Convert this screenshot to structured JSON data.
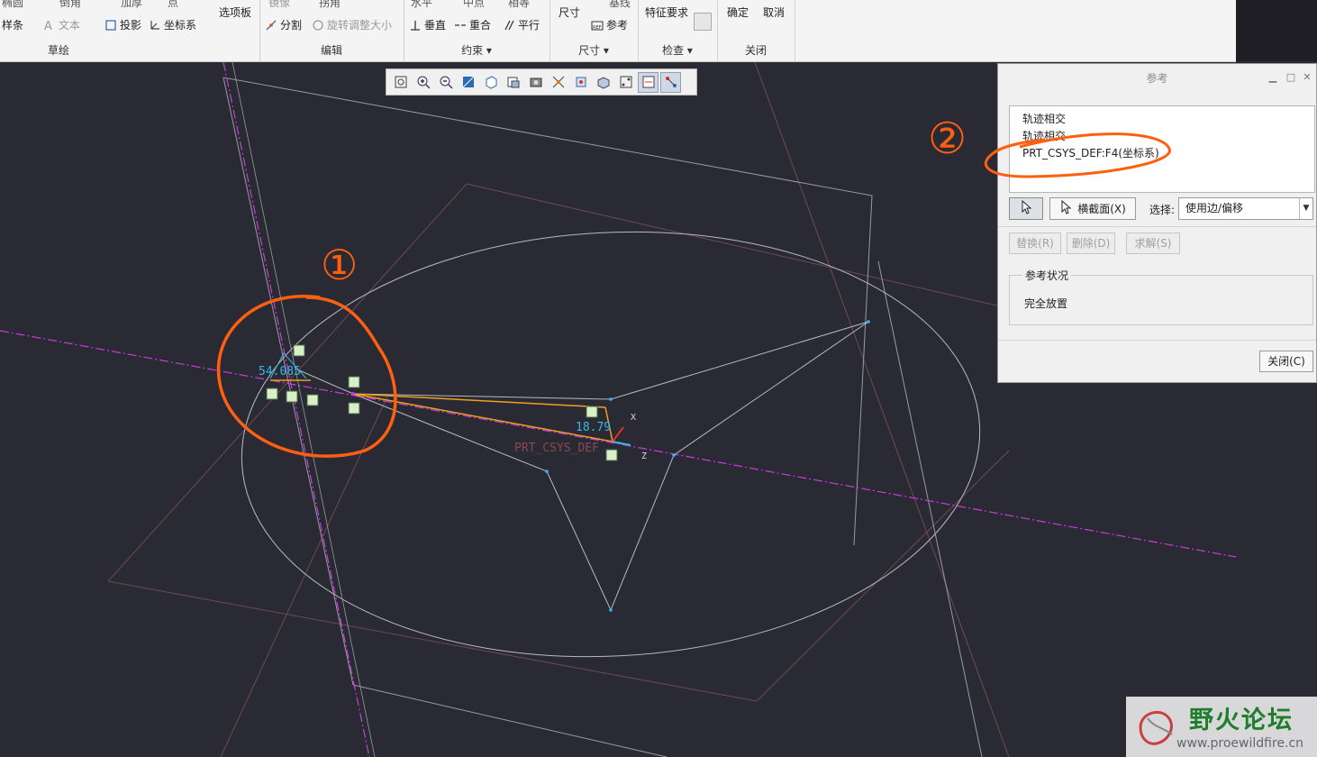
{
  "ribbon": {
    "groups": [
      {
        "label": "草绘",
        "buttons": [
          "样条",
          "文本",
          "投影",
          "坐标系"
        ],
        "cut_top": [
          "椭圆",
          "倒角",
          "加厚",
          "点"
        ]
      },
      {
        "label": "",
        "buttons": [
          "选项板"
        ]
      },
      {
        "label": "编辑",
        "buttons": [
          "分割",
          "旋转调整大小"
        ],
        "cut_top": [
          "镜像",
          "拐角"
        ]
      },
      {
        "label": "约束",
        "buttons": [
          "垂直",
          "重合",
          "平行"
        ],
        "cut_top": [
          "水平",
          "中点",
          "相等"
        ]
      },
      {
        "label": "尺寸",
        "buttons": [
          "尺寸",
          "参考"
        ],
        "cut_top": [
          "基线"
        ]
      },
      {
        "label": "检查",
        "buttons": [
          "特征要求"
        ]
      },
      {
        "label": "关闭",
        "buttons": [
          "确定",
          "取消"
        ]
      }
    ]
  },
  "viewbar": {
    "icons": [
      "refit-icon",
      "zoom-in-icon",
      "zoom-out-icon",
      "repaint-icon",
      "display-style-icon",
      "saved-orientations-icon",
      "view-manager-icon",
      "datum-display-icon",
      "spin-center-icon",
      "annotation-display-icon",
      "sketcher-display-icon",
      "sketch-view-icon",
      "constraint-display-icon"
    ]
  },
  "canvas": {
    "dim1": "54.085",
    "dim2": "18.79",
    "csys_label": "PRT_CSYS_DEF",
    "axis_x": "X",
    "axis_z": "Z",
    "annotation1": "①",
    "annotation2": "②",
    "colors": {
      "background": "#2a2a35",
      "sketch": "#f0a020",
      "geometry": "#c8c8d0",
      "datum": "#c83cdc",
      "annotation": "#ff6010",
      "dimension": "#39b8e6"
    }
  },
  "dialog": {
    "title": "参考",
    "references": [
      "轨迹相交",
      "轨迹相交",
      "PRT_CSYS_DEF:F4(坐标系)"
    ],
    "xsec_button": "横截面(X)",
    "select_label": "选择:",
    "select_value": "使用边/偏移",
    "buttons": [
      "替换(R)",
      "删除(D)",
      "求解(S)"
    ],
    "status_legend": "参考状况",
    "status_value": "完全放置",
    "close_label": "关闭(C)"
  },
  "watermark": {
    "title": "野火论坛",
    "url": "www.proewildfire.cn"
  }
}
